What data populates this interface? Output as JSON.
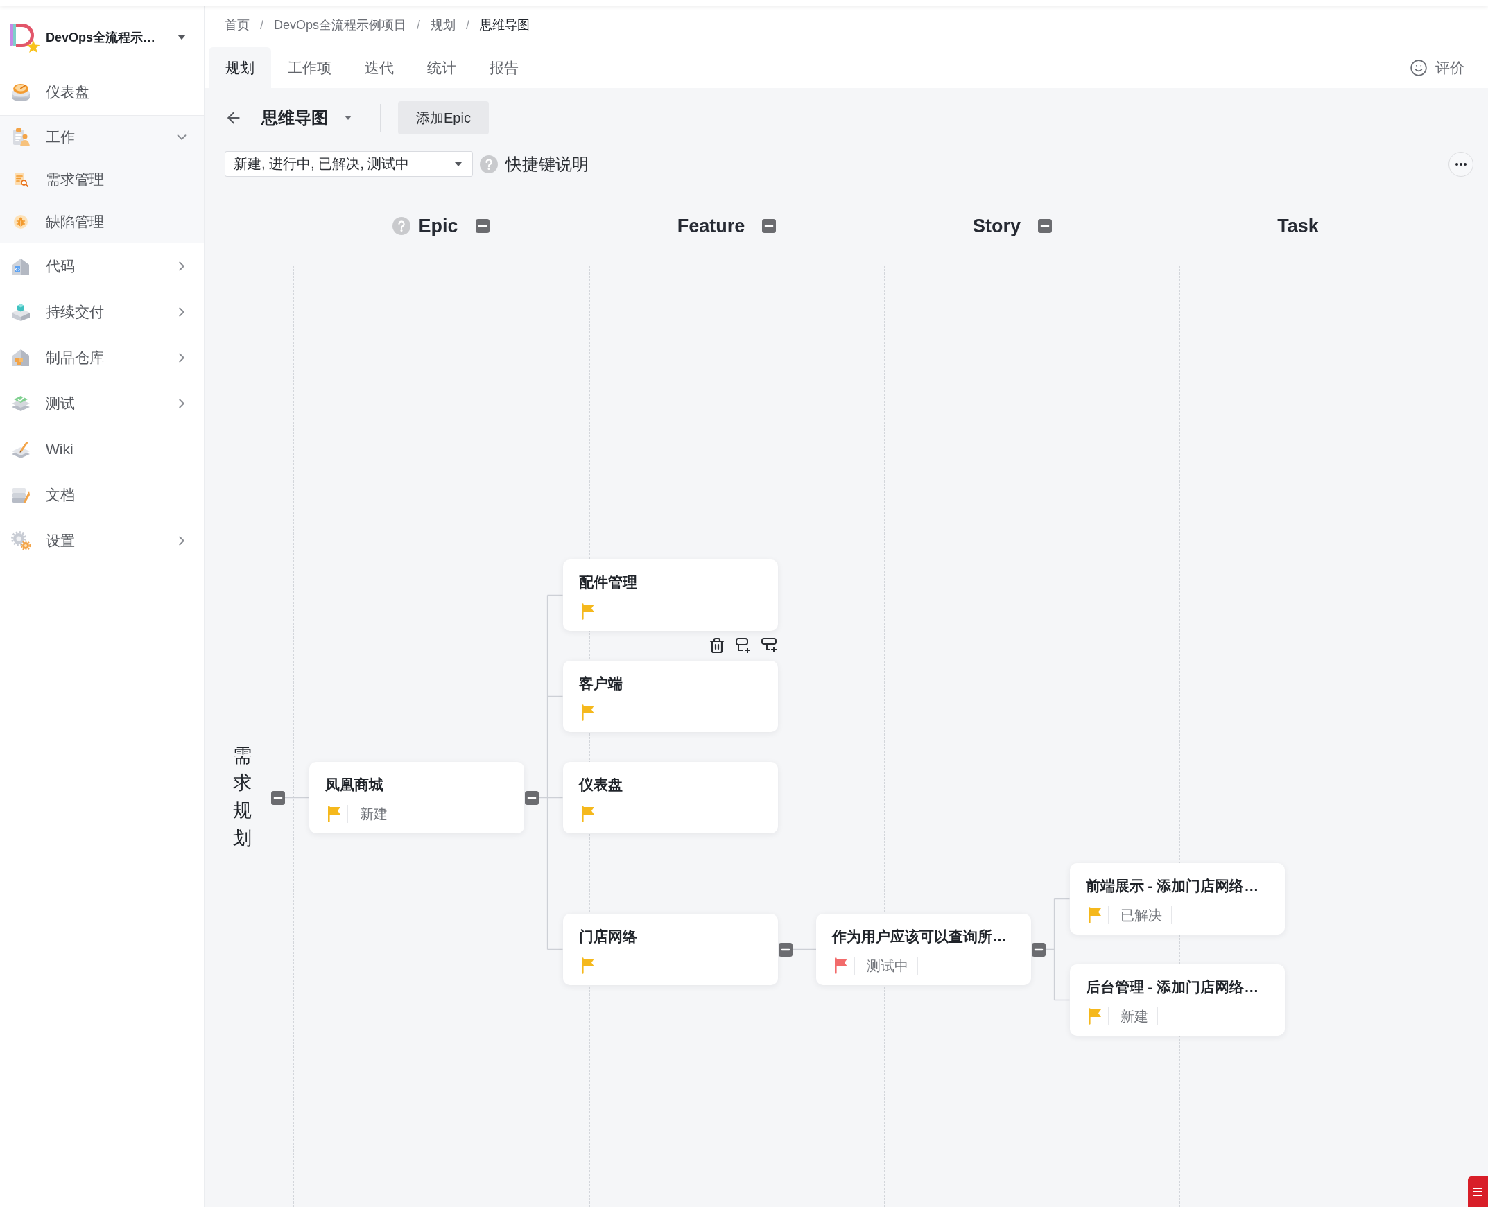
{
  "sidebar": {
    "project": {
      "name": "DevOps全流程示…"
    },
    "items": [
      {
        "label": "仪表盘",
        "kind": "link"
      },
      {
        "label": "工作",
        "kind": "group",
        "expanded": true,
        "children": [
          {
            "label": "需求管理"
          },
          {
            "label": "缺陷管理"
          }
        ]
      },
      {
        "label": "代码",
        "kind": "group",
        "expanded": false
      },
      {
        "label": "持续交付",
        "kind": "group",
        "expanded": false
      },
      {
        "label": "制品仓库",
        "kind": "group",
        "expanded": false
      },
      {
        "label": "测试",
        "kind": "group",
        "expanded": false
      },
      {
        "label": "Wiki",
        "kind": "link"
      },
      {
        "label": "文档",
        "kind": "link"
      },
      {
        "label": "设置",
        "kind": "group",
        "expanded": false
      }
    ]
  },
  "breadcrumb": [
    {
      "label": "首页"
    },
    {
      "separator": "/",
      "label": "DevOps全流程示例项目"
    },
    {
      "separator": "/",
      "label": "规划"
    },
    {
      "separator": "/",
      "label": "思维导图"
    }
  ],
  "tabs": [
    {
      "label": "规划",
      "selected": true
    },
    {
      "label": "工作项",
      "selected": false
    },
    {
      "label": "迭代",
      "selected": false
    },
    {
      "label": "统计",
      "selected": false
    },
    {
      "label": "报告",
      "selected": false
    }
  ],
  "feedback": {
    "label": "评价"
  },
  "toolbar": {
    "view": {
      "label": "思维导图"
    },
    "add_button": {
      "label": "添加Epic"
    }
  },
  "filter": {
    "value": "新建, 进行中, 已解决, 测试中",
    "shortcut_help": {
      "label": "快捷键说明"
    }
  },
  "mind_map": {
    "columns": [
      {
        "label": "Epic",
        "help": true,
        "collapsible": true
      },
      {
        "label": "Feature",
        "help": false,
        "collapsible": true
      },
      {
        "label": "Story",
        "help": false,
        "collapsible": true
      },
      {
        "label": "Task",
        "help": false,
        "collapsible": false
      }
    ],
    "root": {
      "label": "需求规划",
      "expanded": true,
      "children": [
        {
          "title": "凤凰商城",
          "status": "新建",
          "flag": {
            "color": "#f5b81c"
          },
          "hovered": false,
          "expanded": true,
          "children": [
            {
              "title": "配件管理",
              "flag": {
                "color": "#f5b81c"
              },
              "hovered": true
            },
            {
              "title": "客户端",
              "flag": {
                "color": "#f5b81c"
              },
              "hovered": false
            },
            {
              "title": "仪表盘",
              "flag": {
                "color": "#f5b81c"
              },
              "hovered": false
            },
            {
              "title": "门店网络",
              "flag": {
                "color": "#f5b81c"
              },
              "hovered": false,
              "expanded": true,
              "children": [
                {
                  "title": "作为用户应该可以查询所…",
                  "status": "测试中",
                  "flag": {
                    "color": "#f26b6b"
                  },
                  "hovered": false,
                  "expanded": true,
                  "children": [
                    {
                      "title": "前端展示 - 添加门店网络…",
                      "status": "已解决",
                      "flag": {
                        "color": "#f5b81c"
                      },
                      "hovered": false
                    },
                    {
                      "title": "后台管理 - 添加门店网络…",
                      "status": "新建",
                      "flag": {
                        "color": "#f5b81c"
                      },
                      "hovered": false
                    }
                  ]
                }
              ]
            }
          ]
        }
      ]
    }
  }
}
